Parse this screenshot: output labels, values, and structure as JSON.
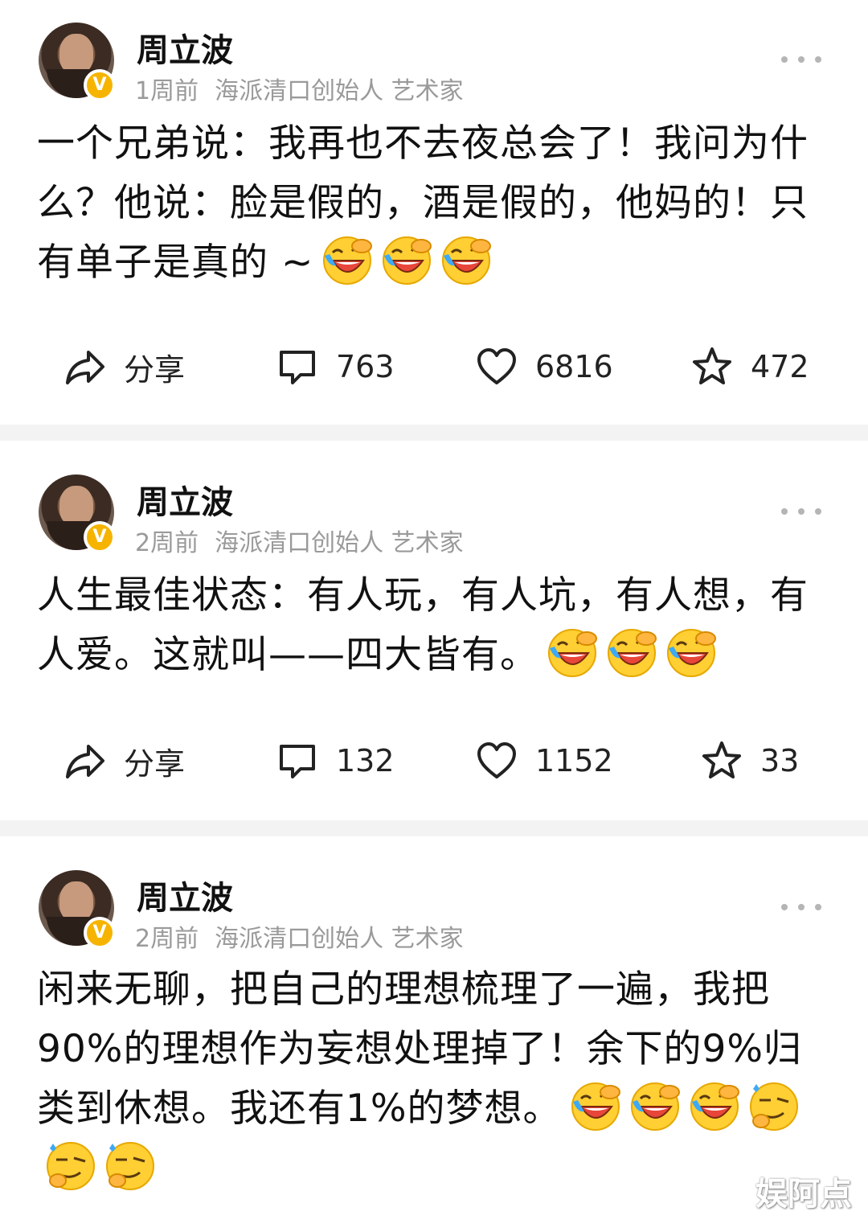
{
  "posts": [
    {
      "author": "周立波",
      "time": "1周前",
      "bio": "海派清口创始人 艺术家",
      "verified_badge": "V",
      "text": "一个兄弟说：我再也不去夜总会了！我问为什么？他说：脸是假的，酒是假的，他妈的！只有单子是真的 ~",
      "emojis": [
        "laugh-cry-emoji",
        "laugh-cry-emoji",
        "laugh-cry-emoji"
      ],
      "share_label": "分享",
      "comments": "763",
      "likes": "6816",
      "favorites": "472"
    },
    {
      "author": "周立波",
      "time": "2周前",
      "bio": "海派清口创始人 艺术家",
      "verified_badge": "V",
      "text": "人生最佳状态：有人玩，有人坑，有人想，有人爱。这就叫——四大皆有。",
      "emojis": [
        "laugh-cry-emoji",
        "laugh-cry-emoji",
        "laugh-cry-emoji"
      ],
      "share_label": "分享",
      "comments": "132",
      "likes": "1152",
      "favorites": "33"
    },
    {
      "author": "周立波",
      "time": "2周前",
      "bio": "海派清口创始人 艺术家",
      "verified_badge": "V",
      "text": "闲来无聊，把自己的理想梳理了一遍，我把90%的理想作为妄想处理掉了！余下的9%归类到休想。我还有1%的梦想。",
      "emojis": [
        "laugh-cry-emoji",
        "laugh-cry-emoji",
        "laugh-cry-emoji",
        "smirk-emoji",
        "smirk-emoji",
        "smirk-emoji"
      ]
    }
  ],
  "watermark": "娱阿点",
  "colors": {
    "badge": "#f6b400",
    "meta": "#9a9a9a",
    "separator": "#f3f3f3"
  }
}
